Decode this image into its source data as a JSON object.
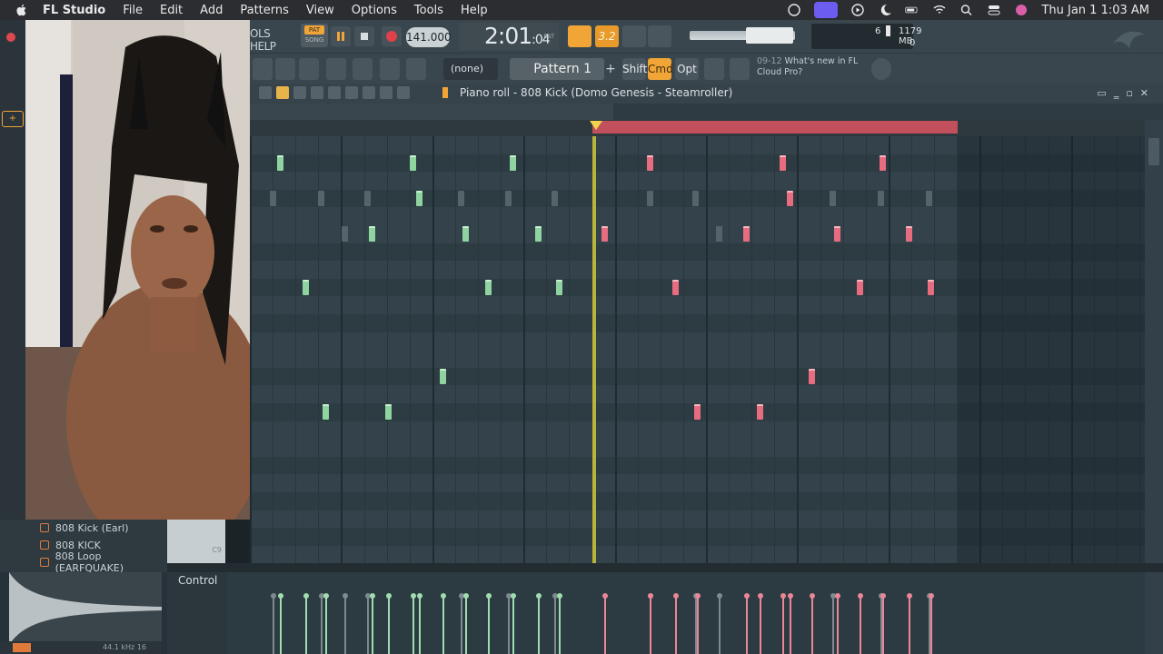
{
  "menubar": {
    "app_name": "FL Studio",
    "menus": [
      "File",
      "Edit",
      "Add",
      "Patterns",
      "View",
      "Options",
      "Tools",
      "Help"
    ],
    "clock": "Thu Jan 1  1:03 AM"
  },
  "toolbar": {
    "hint_tab": "OLS HELP",
    "pat_label": "PAT",
    "song_label": "SONG",
    "tempo": "141.000",
    "time_main": "2:01",
    "time_sub": "04",
    "time_label": "B:S:T",
    "snap_label": "3.2",
    "cpu": "6",
    "memory": "1179 MB",
    "polyphony": "0",
    "channel_select": "(none)",
    "pattern": "Pattern 1",
    "pattern_add": "+",
    "shift_label": "Shift",
    "cmd_label": "Cmd",
    "opt_label": "Opt",
    "news_number": "09-12",
    "news_text": "What's new in FL",
    "news_text2": "Cloud Pro?"
  },
  "piano_roll": {
    "title": "Piano roll - 808 Kick (Domo Genesis - Steamroller)",
    "control_label": "Control",
    "notes_green": [
      {
        "pos": 0.03,
        "row": 1
      },
      {
        "pos": 0.175,
        "row": 1
      },
      {
        "pos": 0.285,
        "row": 1
      },
      {
        "pos": 0.182,
        "row": 3
      },
      {
        "pos": 0.13,
        "row": 5
      },
      {
        "pos": 0.233,
        "row": 5
      },
      {
        "pos": 0.312,
        "row": 5
      },
      {
        "pos": 0.058,
        "row": 8
      },
      {
        "pos": 0.258,
        "row": 8
      },
      {
        "pos": 0.335,
        "row": 8
      },
      {
        "pos": 0.208,
        "row": 13
      },
      {
        "pos": 0.08,
        "row": 15
      },
      {
        "pos": 0.148,
        "row": 15
      }
    ],
    "notes_pink": [
      {
        "pos": 0.385,
        "row": 5
      },
      {
        "pos": 0.435,
        "row": 1
      },
      {
        "pos": 0.58,
        "row": 1
      },
      {
        "pos": 0.69,
        "row": 1
      },
      {
        "pos": 0.588,
        "row": 3
      },
      {
        "pos": 0.54,
        "row": 5
      },
      {
        "pos": 0.64,
        "row": 5
      },
      {
        "pos": 0.718,
        "row": 5
      },
      {
        "pos": 0.463,
        "row": 8
      },
      {
        "pos": 0.665,
        "row": 8
      },
      {
        "pos": 0.742,
        "row": 8
      },
      {
        "pos": 0.612,
        "row": 13
      },
      {
        "pos": 0.487,
        "row": 15
      },
      {
        "pos": 0.555,
        "row": 15
      }
    ],
    "notes_ghost": [
      {
        "pos": 0.022,
        "row": 3
      },
      {
        "pos": 0.075,
        "row": 3
      },
      {
        "pos": 0.125,
        "row": 3
      },
      {
        "pos": 0.228,
        "row": 3
      },
      {
        "pos": 0.28,
        "row": 3
      },
      {
        "pos": 0.33,
        "row": 3
      },
      {
        "pos": 0.435,
        "row": 3
      },
      {
        "pos": 0.485,
        "row": 3
      },
      {
        "pos": 0.635,
        "row": 3
      },
      {
        "pos": 0.688,
        "row": 3
      },
      {
        "pos": 0.74,
        "row": 3
      },
      {
        "pos": 0.1,
        "row": 5
      },
      {
        "pos": 0.51,
        "row": 5
      }
    ]
  },
  "browser": {
    "items": [
      "808 Kick (Earl)",
      "808 KICK",
      "808 Loop (EARFQUAKE)"
    ],
    "thumb_label": "C9",
    "sample_rate": "44.1 kHz 16"
  },
  "colors": {
    "accent": "#f0a536",
    "note_green": "#8fd3a0",
    "note_pink": "#e86c80",
    "loop_bar": "#c2505c",
    "playhead": "#f3d34a"
  }
}
